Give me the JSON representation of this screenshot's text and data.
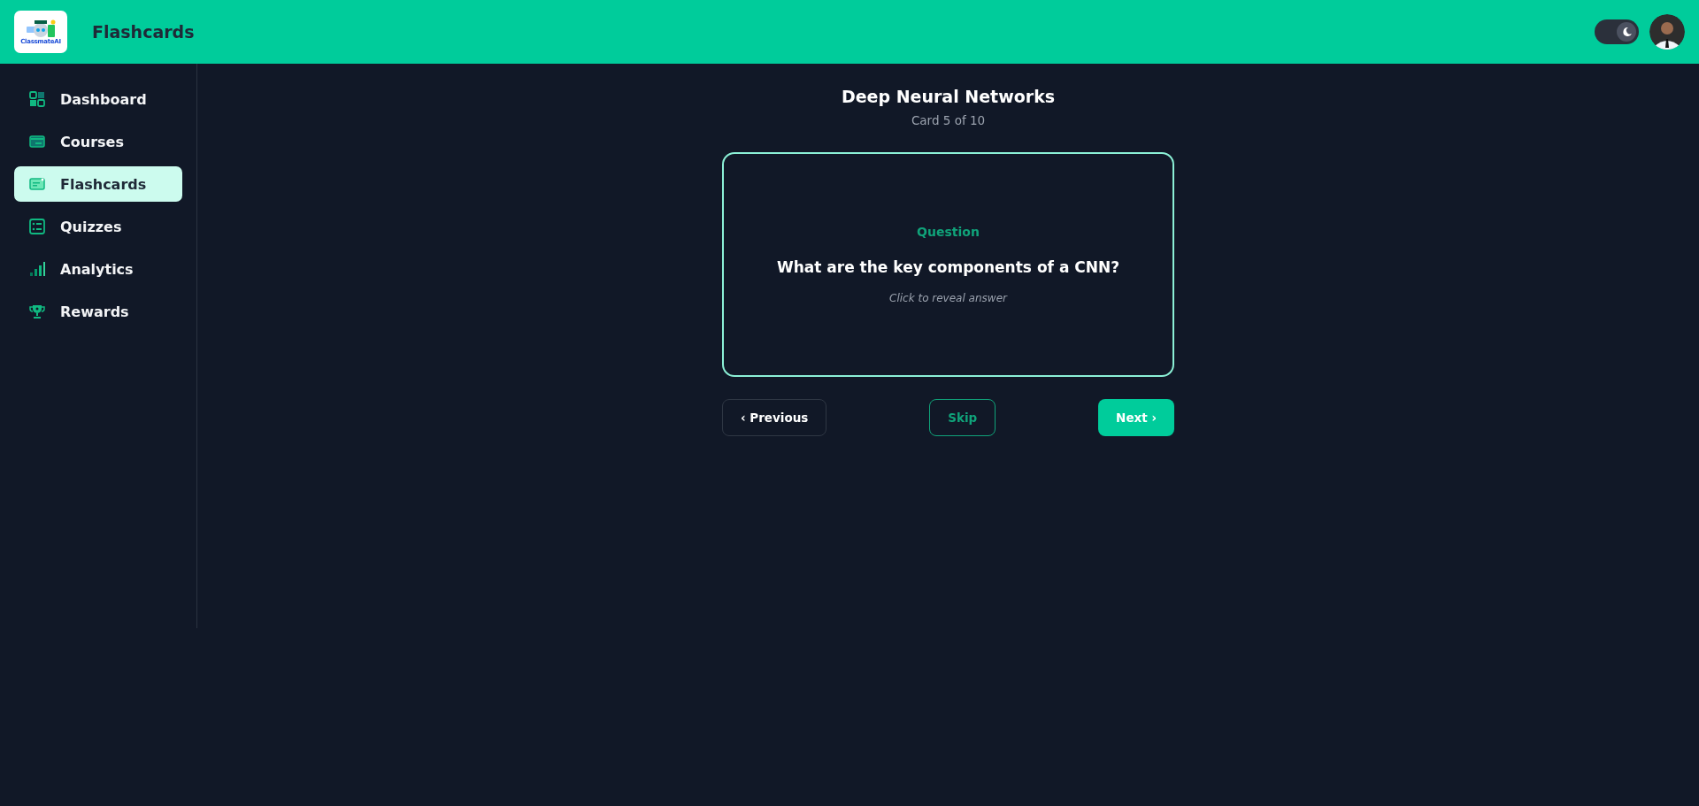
{
  "header": {
    "logo_text": "ClassmateAI",
    "title": "Flashcards",
    "dark_mode": true
  },
  "sidebar": {
    "items": [
      {
        "label": "Dashboard",
        "kind": "dashboard",
        "selected": false
      },
      {
        "label": "Courses",
        "kind": "courses",
        "selected": false
      },
      {
        "label": "Flashcards",
        "kind": "flashcards",
        "selected": true
      },
      {
        "label": "Quizzes",
        "kind": "quizzes",
        "selected": false
      },
      {
        "label": "Analytics",
        "kind": "analytics",
        "selected": false
      },
      {
        "label": "Rewards",
        "kind": "rewards",
        "selected": false
      }
    ]
  },
  "deck": {
    "title": "Deep Neural Networks",
    "progress": "Card 5 of 10"
  },
  "card": {
    "label": "Question",
    "text": "What are the key components of a CNN?",
    "hint": "Click to reveal answer"
  },
  "buttons": [
    {
      "label": "‹ Previous",
      "kind": "outline"
    },
    {
      "label": "Skip",
      "kind": "accent"
    },
    {
      "label": "Next ›",
      "kind": "primary"
    }
  ]
}
